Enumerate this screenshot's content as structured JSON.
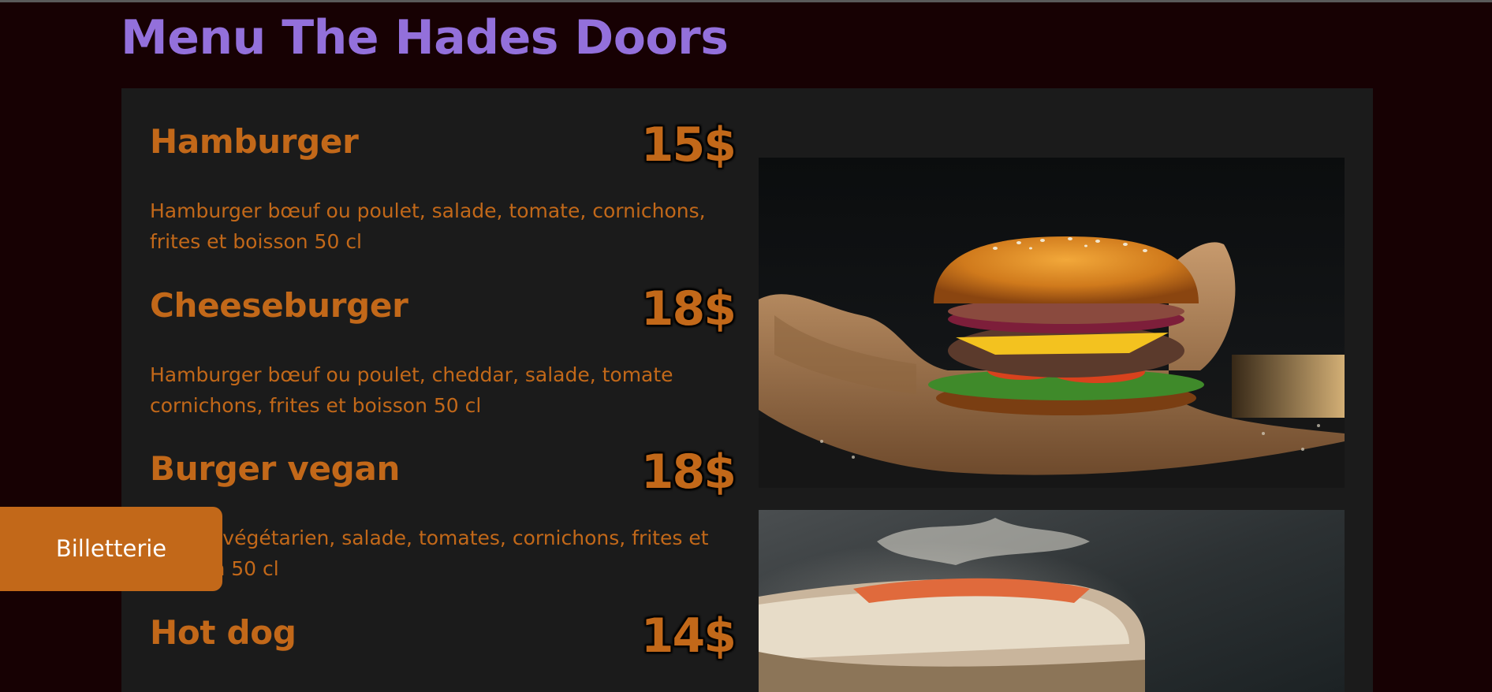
{
  "page": {
    "title": "Menu The Hades Doors"
  },
  "menu": {
    "items": [
      {
        "name": "Hamburger",
        "price": "15$",
        "description": "Hamburger bœuf ou poulet, salade, tomate, cornichons, frites et boisson 50 cl"
      },
      {
        "name": "Cheeseburger",
        "price": "18$",
        "description": "Hamburger bœuf ou poulet, cheddar, salade, tomate cornichons, frites et boisson 50 cl"
      },
      {
        "name": "Burger vegan",
        "price": "18$",
        "description": "Burger végétarien, salade, tomates, cornichons, frites et boisson 50 cl"
      },
      {
        "name": "Hot dog",
        "price": "14$",
        "description": ""
      }
    ]
  },
  "nav": {
    "billetterie_label": "Billetterie"
  },
  "colors": {
    "background": "#170103",
    "panel": "#1b1b1b",
    "accent": "#c26819",
    "title": "#9370db"
  }
}
